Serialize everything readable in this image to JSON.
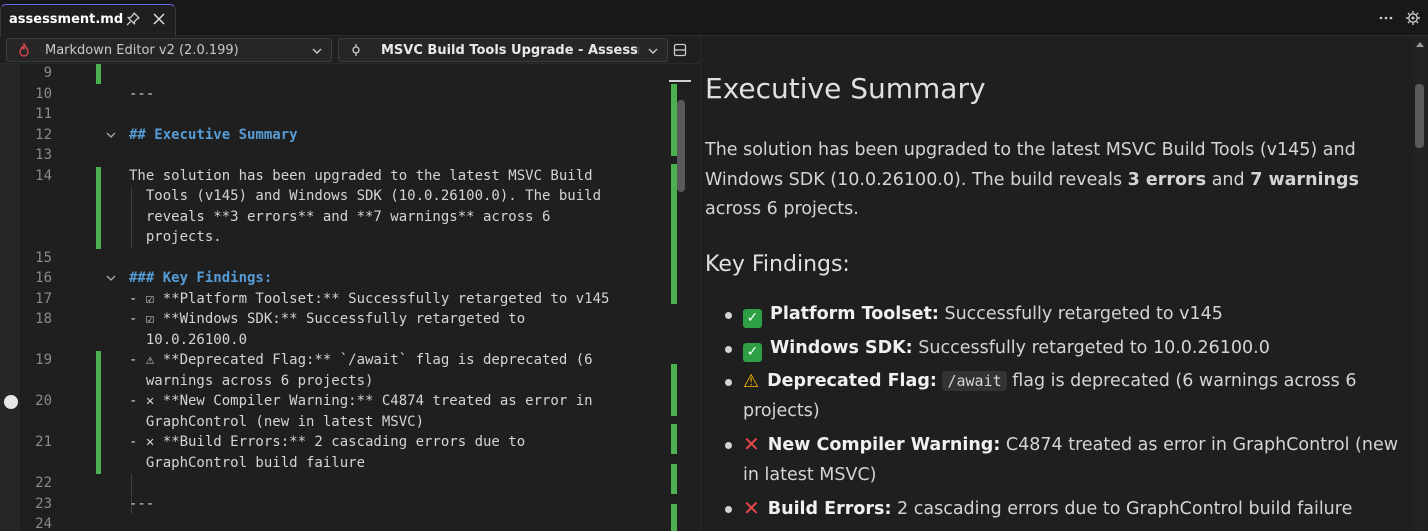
{
  "tab": {
    "title": "assessment.md",
    "pin_icon": "pin-icon",
    "close_icon": "close-icon"
  },
  "toolbar": {
    "editor_selector": "Markdown Editor v2 (2.0.199)",
    "document_selector": "MSVC Build Tools Upgrade - Assessment"
  },
  "editor": {
    "lines": [
      {
        "num": "9",
        "text": ""
      },
      {
        "num": "10",
        "text": "---"
      },
      {
        "num": "11",
        "text": ""
      },
      {
        "num": "12",
        "text": "## Executive Summary"
      },
      {
        "num": "13",
        "text": ""
      },
      {
        "num": "14",
        "text": "The solution has been upgraded to the latest MSVC Build"
      },
      {
        "num": "",
        "text": "  Tools (v145) and Windows SDK (10.0.26100.0). The build"
      },
      {
        "num": "",
        "text": "  reveals **3 errors** and **7 warnings** across 6"
      },
      {
        "num": "",
        "text": "  projects."
      },
      {
        "num": "15",
        "text": ""
      },
      {
        "num": "16",
        "text": "### Key Findings:"
      },
      {
        "num": "17",
        "text": "- ☑ **Platform Toolset:** Successfully retargeted to v145"
      },
      {
        "num": "18",
        "text": "- ☑ **Windows SDK:** Successfully retargeted to"
      },
      {
        "num": "",
        "text": "  10.0.26100.0"
      },
      {
        "num": "19",
        "text": "- ⚠ **Deprecated Flag:** `/await` flag is deprecated (6"
      },
      {
        "num": "",
        "text": "  warnings across 6 projects)"
      },
      {
        "num": "20",
        "text": "- ✕ **New Compiler Warning:** C4874 treated as error in"
      },
      {
        "num": "",
        "text": "  GraphControl (new in latest MSVC)"
      },
      {
        "num": "21",
        "text": "- ✕ **Build Errors:** 2 cascading errors due to"
      },
      {
        "num": "",
        "text": "  GraphControl build failure"
      },
      {
        "num": "22",
        "text": ""
      },
      {
        "num": "23",
        "text": "---"
      },
      {
        "num": "24",
        "text": ""
      }
    ]
  },
  "preview": {
    "h1": "Executive Summary",
    "para_part1": "The solution has been upgraded to the latest MSVC Build Tools (v145) and Windows SDK (10.0.26100.0). The build reveals ",
    "para_bold1": "3 errors",
    "para_part2": " and ",
    "para_bold2": "7 warnings",
    "para_part3": " across 6 projects.",
    "h3": "Key Findings:",
    "items": [
      {
        "label": "Platform Toolset:",
        "text": " Successfully retargeted to v145"
      },
      {
        "label": "Windows SDK:",
        "text": " Successfully retargeted to 10.0.26100.0"
      },
      {
        "label": "Deprecated Flag:",
        "code": "/await",
        "text": " flag is deprecated (6 warnings across 6 projects)"
      },
      {
        "label": "New Compiler Warning:",
        "text": " C4874 treated as error in GraphControl (new in latest MSVC)"
      },
      {
        "label": "Build Errors:",
        "text": " 2 cascading errors due to GraphControl build failure"
      }
    ]
  },
  "colors": {
    "accent": "#569cd6",
    "diff_added": "#4caf50",
    "success": "#2ea043",
    "warning": "#f5b700",
    "error": "#e5484d"
  }
}
